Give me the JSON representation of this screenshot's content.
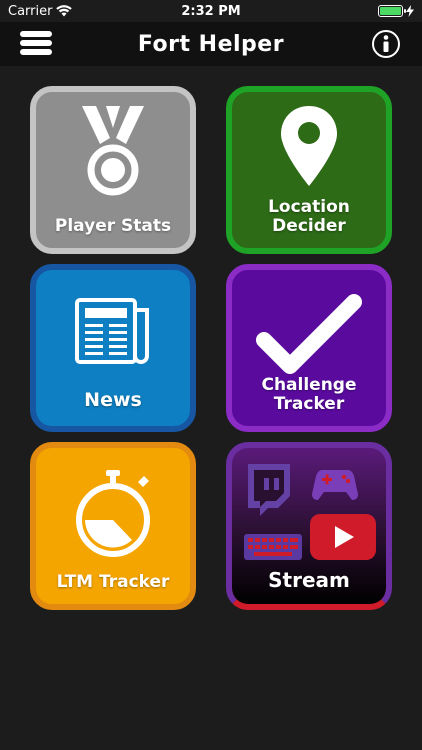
{
  "status_bar": {
    "carrier": "Carrier",
    "time": "2:32 PM",
    "battery_level": 1.0
  },
  "nav": {
    "title": "Fort Helper",
    "menu_icon": "hamburger-menu-icon",
    "info_icon": "info-icon"
  },
  "tiles": [
    {
      "label": "Player Stats",
      "icon": "medal-icon",
      "color": "#8e8e8e",
      "border": "#c4c4c4"
    },
    {
      "label": "Location Decider",
      "icon": "map-pin-icon",
      "color": "#2d6b17",
      "border": "#1fa327"
    },
    {
      "label": "News",
      "icon": "newspaper-icon",
      "color": "#0e7fc2",
      "border": "#1756a3"
    },
    {
      "label": "Challenge Tracker",
      "icon": "checkmark-icon",
      "color": "#5a0b9e",
      "border": "#8b2cc7"
    },
    {
      "label": "LTM Tracker",
      "icon": "stopwatch-icon",
      "color": "#f5a500",
      "border": "#e38b10"
    },
    {
      "label": "Stream",
      "icon": "streaming-icons",
      "color": "#2a1030",
      "border": "#d01c2a"
    }
  ]
}
